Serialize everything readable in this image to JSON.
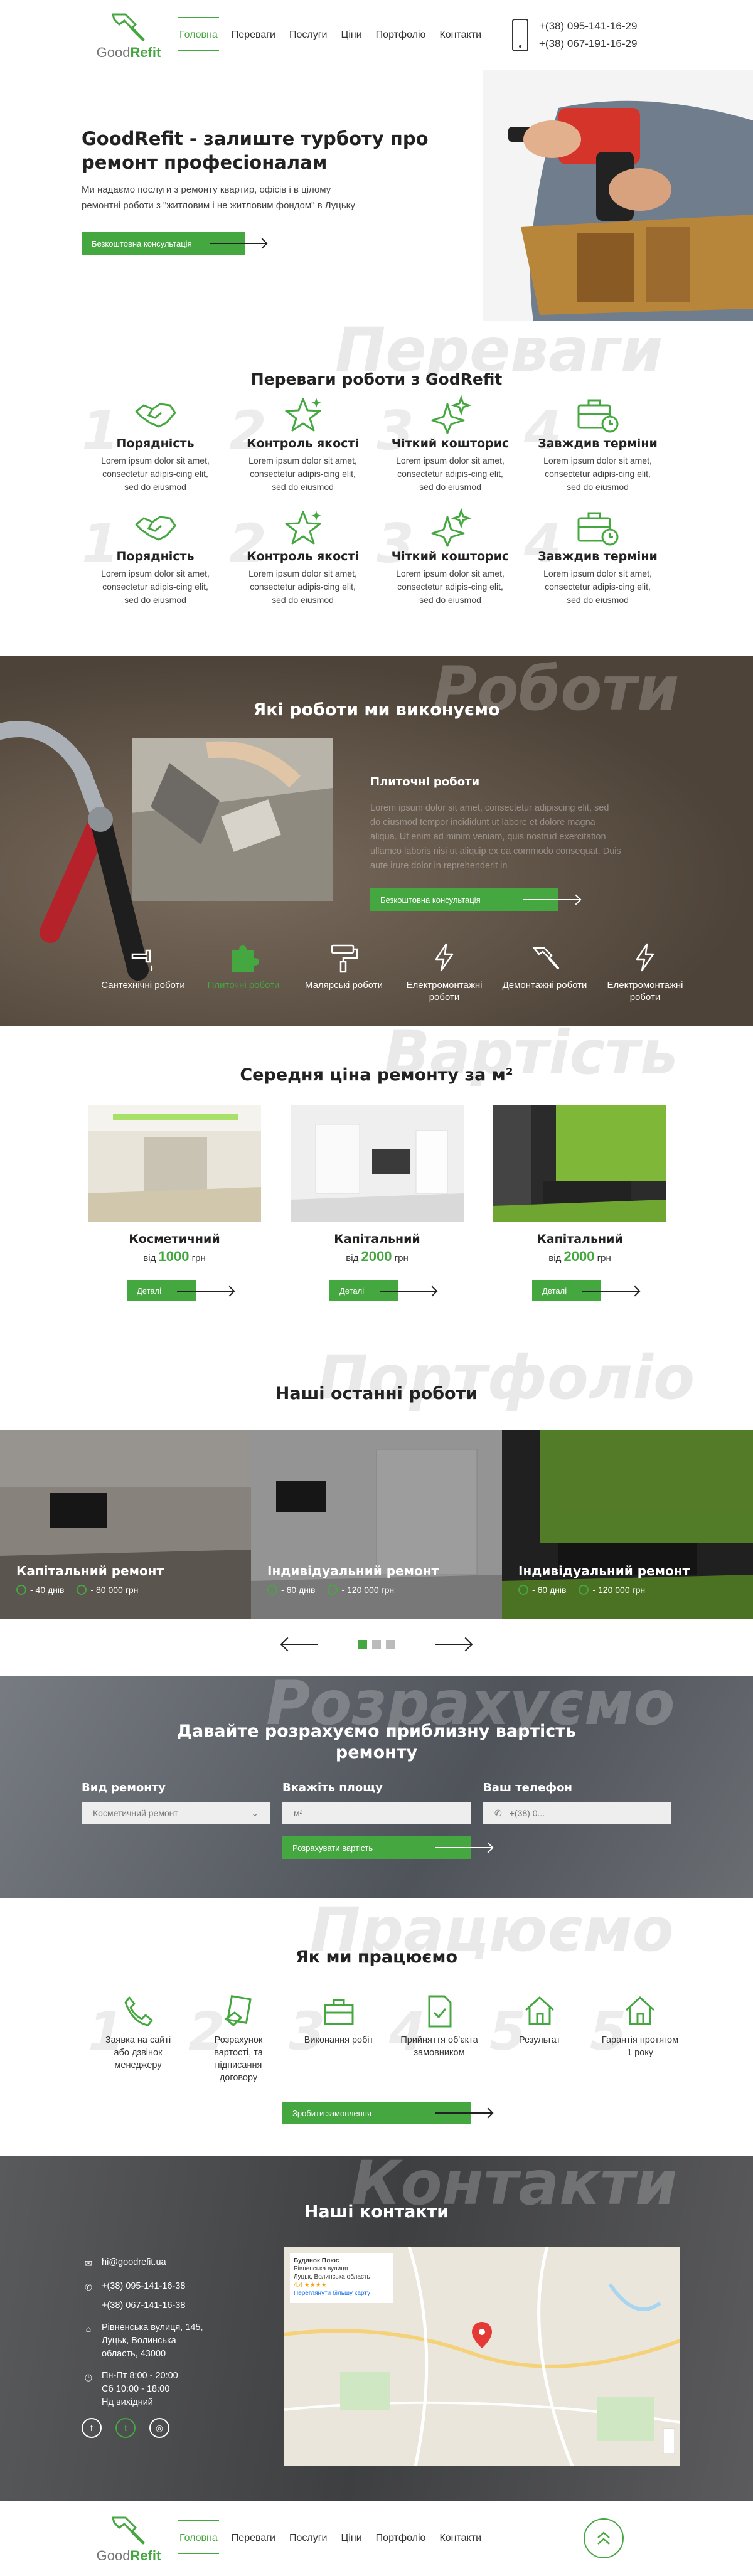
{
  "brand": {
    "logo_left": "Good",
    "logo_right": "Refit",
    "accent": "#45a740"
  },
  "nav": {
    "items": [
      "Головна",
      "Переваги",
      "Послуги",
      "Ціни",
      "Портфоліо",
      "Контакти"
    ],
    "active": 0
  },
  "phones": [
    "+(38) 095-141-16-29",
    "+(38) 067-191-16-29"
  ],
  "hero": {
    "title": "GoodRefit - залиште турботу про ремонт професіоналам",
    "text": "Ми надаємо послуги з ремонту квартир, офісів і в цілому ремонтні роботи з \"житловим і не житловим фондом\" в Луцьку",
    "button": "Безкоштовна консультація"
  },
  "features": {
    "watermark": "Переваги",
    "title": "Переваги роботи з GodRefit",
    "items": [
      {
        "num": "1",
        "title": "Порядність",
        "text": "Lorem ipsum dolor sit amet, consectetur adipis-cing elit, sed do eiusmod",
        "icon": "handshake-icon"
      },
      {
        "num": "2",
        "title": "Контроль якості",
        "text": "Lorem ipsum dolor sit amet, consectetur adipis-cing elit, sed do eiusmod",
        "icon": "star-icon"
      },
      {
        "num": "3",
        "title": "Чіткий кошторис",
        "text": "Lorem ipsum dolor sit amet, consectetur adipis-cing elit, sed do eiusmod",
        "icon": "sparkle-icon"
      },
      {
        "num": "4",
        "title": "Завждив терміни",
        "text": "Lorem ipsum dolor sit amet, consectetur adipis-cing elit, sed do eiusmod",
        "icon": "briefcase-clock-icon"
      },
      {
        "num": "1",
        "title": "Порядність",
        "text": "Lorem ipsum dolor sit amet, consectetur adipis-cing elit, sed do eiusmod",
        "icon": "handshake-icon"
      },
      {
        "num": "2",
        "title": "Контроль якості",
        "text": "Lorem ipsum dolor sit amet, consectetur adipis-cing elit, sed do eiusmod",
        "icon": "star-icon"
      },
      {
        "num": "3",
        "title": "Чіткий кошторис",
        "text": "Lorem ipsum dolor sit amet, consectetur adipis-cing elit, sed do eiusmod",
        "icon": "sparkle-icon"
      },
      {
        "num": "4",
        "title": "Завждив терміни",
        "text": "Lorem ipsum dolor sit amet, consectetur adipis-cing elit, sed do eiusmod",
        "icon": "briefcase-clock-icon"
      }
    ]
  },
  "works": {
    "watermark": "Роботи",
    "title": "Які роботи ми виконуємо",
    "active_title": "Плиточні роботи",
    "active_text": "Lorem ipsum dolor sit amet, consectetur adipiscing elit, sed do eiusmod tempor incididunt ut labore et dolore magna aliqua. Ut enim ad minim veniam, quis nostrud exercitation ullamco laboris nisi ut aliquip ex ea commodo consequat. Duis aute irure dolor in reprehenderit in",
    "button": "Безкоштовна консультація",
    "services": [
      {
        "label": "Сантехнічні роботи",
        "icon": "faucet-icon"
      },
      {
        "label": "Плиточні роботи",
        "icon": "puzzle-icon"
      },
      {
        "label": "Малярські роботи",
        "icon": "paint-roller-icon"
      },
      {
        "label": "Електромонтажні роботи",
        "icon": "lightning-icon"
      },
      {
        "label": "Демонтажні роботи",
        "icon": "hammer-icon"
      },
      {
        "label": "Електромонтажні роботи",
        "icon": "lightning-icon"
      }
    ],
    "active_service": 1
  },
  "prices": {
    "watermark": "Вартість",
    "title": "Середня ціна ремонту за м²",
    "from_label": "від",
    "currency": "грн",
    "button": "Деталі",
    "items": [
      {
        "title": "Косметичний",
        "price": "1000"
      },
      {
        "title": "Капітальний",
        "price": "2000"
      },
      {
        "title": "Капітальний",
        "price": "2000"
      }
    ]
  },
  "portfolio": {
    "watermark": "Портфоліо",
    "title": "Наші останні роботи",
    "slides": [
      {
        "title": "Капітальний ремонт",
        "days": "- 40 днів",
        "cost": "- 80 000 грн"
      },
      {
        "title": "Індивідуальний ремонт",
        "days": "- 60 днів",
        "cost": "- 120 000 грн"
      },
      {
        "title": "Індивідуальний ремонт",
        "days": "- 60 днів",
        "cost": "- 120 000 грн"
      }
    ],
    "active_dot": 0
  },
  "calc": {
    "watermark": "Розрахуємо",
    "title": "Давайте розрахуємо приблизну вартість ремонту",
    "type_label": "Вид ремонту",
    "type_value": "Косметичний ремонт",
    "area_label": "Вкажіть площу",
    "area_placeholder": "м²",
    "phone_label": "Ваш телефон",
    "phone_placeholder": "+(38) 0...",
    "button": "Розрахувати вартість"
  },
  "how": {
    "watermark": "Працюємо",
    "title": "Як ми працюємо",
    "steps": [
      {
        "num": "1",
        "text": "Заявка на сайті або дзвінок менеджеру",
        "icon": "phone-icon"
      },
      {
        "num": "2",
        "text": "Розрахунок вартості, та підписання договору",
        "icon": "contract-icon"
      },
      {
        "num": "3",
        "text": "Виконання робіт",
        "icon": "toolbox-icon"
      },
      {
        "num": "4",
        "text": "Прийняття об'єкта замовником",
        "icon": "document-check-icon"
      },
      {
        "num": "5",
        "text": "Результат",
        "icon": "house-icon"
      },
      {
        "num": "5",
        "text": "Гарантія протягом 1 року",
        "icon": "house-icon"
      }
    ],
    "button": "Зробити замовлення"
  },
  "contacts": {
    "watermark": "Контакти",
    "title": "Наші контакти",
    "email": "hi@goodrefit.ua",
    "phone1": "+(38) 095-141-16-38",
    "phone2": "+(38) 067-141-16-38",
    "address": "Рівненська вулиця, 145, Луцьк, Волинська область, 43000",
    "hours1": "Пн-Пт 8:00 - 20:00",
    "hours2": "Сб 10:00 - 18:00",
    "hours3": "Нд вихідний",
    "map_card": {
      "title": "Будинок Плюс",
      "line1": "Рівненська вулиця",
      "line2": "Луцьк, Волинська область",
      "rating": "4.4 ★★★★",
      "link": "Переглянути більшу карту"
    }
  }
}
